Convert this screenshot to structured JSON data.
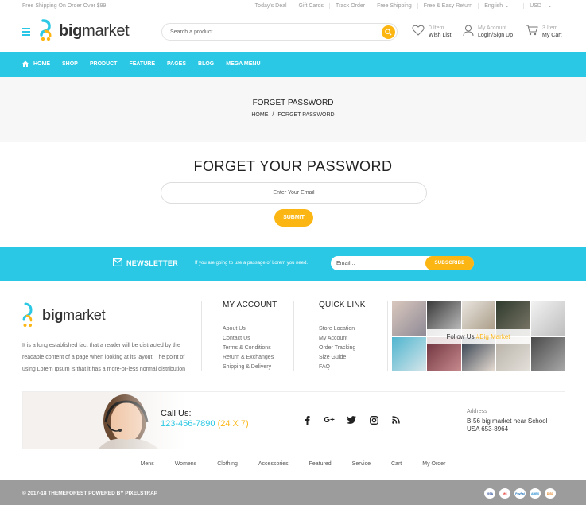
{
  "topbar": {
    "shipping_note": "Free Shipping On Order Over $99",
    "links": [
      "Today's Deal",
      "Gift Cards",
      "Track Order",
      "Free Shipping",
      "Free & Easy Return"
    ],
    "language": "English",
    "currency": "USD"
  },
  "header": {
    "logo_bold": "big",
    "logo_light": "market",
    "search_placeholder": "Search a product",
    "wishlist_count": "0 Item",
    "wishlist_label": "Wish List",
    "account_small": "My Account",
    "account_label": "Login/Sign Up",
    "cart_count": "3 Item",
    "cart_label": "My Cart"
  },
  "nav": {
    "items": [
      "HOME",
      "SHOP",
      "PRODUCT",
      "FEATURE",
      "PAGES",
      "BLOG",
      "MEGA MENU"
    ]
  },
  "breadcrumb": {
    "title": "FORGET PASSWORD",
    "home": "HOME",
    "separator": "/",
    "current": "FORGET PASSWORD"
  },
  "form": {
    "title": "FORGET YOUR PASSWORD",
    "email_placeholder": "Enter Your Email",
    "submit_label": "SUBMIT"
  },
  "newsletter": {
    "title": "NEWSLETTER",
    "description": "If you are going to use a passage of Lorem you need.",
    "email_placeholder": "Email...",
    "subscribe_label": "SUBSCRIBE"
  },
  "footer": {
    "logo_bold": "big",
    "logo_light": "market",
    "about_lines": [
      "It is a long established fact that a reader will be distracted by the",
      "readable content of a page when looking at its layout. The point of",
      "using Lorem Ipsum is that it has a more-or-less normal distribution"
    ],
    "my_account": {
      "title": "MY ACCOUNT",
      "links": [
        "About Us",
        "Contact Us",
        "Terms & Conditions",
        "Return & Exchanges",
        "Shipping & Delivery"
      ]
    },
    "quick_link": {
      "title": "QUICK LINK",
      "links": [
        "Store Location",
        "My Account",
        "Order Tracking",
        "Size Guide",
        "FAQ"
      ]
    },
    "follow_prefix": "Follow Us",
    "follow_tag": "#Big Market"
  },
  "contact": {
    "call_label": "Call Us:",
    "phone": "123-456-7890",
    "hours": "(24 X 7)",
    "socials": [
      "facebook-icon",
      "google-plus-icon",
      "twitter-icon",
      "instagram-icon",
      "rss-icon"
    ],
    "address_label": "Address",
    "address_line1": "B-56 big market near School",
    "address_line2": "USA 653-8964"
  },
  "bottom_links": [
    "Mens",
    "Womens",
    "Clothing",
    "Accessories",
    "Featured",
    "Service",
    "Cart",
    "My Order"
  ],
  "copyright": "© 2017-18 THEMEFOREST POWERED BY PIXELSTRAP",
  "payment_cards": [
    "VISA",
    "MC",
    "PayPal",
    "AMEX",
    "DISC"
  ],
  "colors": {
    "accent_blue": "#2ac8e4",
    "accent_yellow": "#fbb614",
    "footer_bar": "#9c9c9c"
  }
}
